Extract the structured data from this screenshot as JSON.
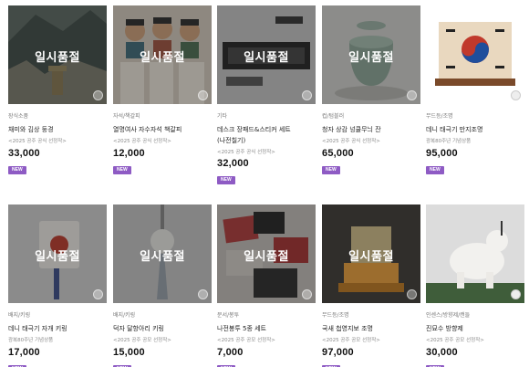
{
  "sold_out_label": "일시품절",
  "new_badge": "NEW",
  "colors": {
    "badge": "#8e5bc4",
    "overlay": "rgba(30,30,30,0.40)"
  },
  "products": [
    {
      "category": "장식소품",
      "name": "채미와 김상 둥경",
      "name2": "",
      "subtitle": "<2025 공주 공식 선정작>",
      "price": "33,000",
      "icon": "mountain-shrine-photo"
    },
    {
      "category": "자석/책갈피",
      "name": "열명여사 자수자석 책갈피",
      "name2": "",
      "subtitle": "<2025 공주 공식 선정작>",
      "price": "12,000",
      "icon": "figurine-magnets-photo"
    },
    {
      "category": "기타",
      "name": "데스크 장패드&스티커 세트",
      "name2": "(나전칠기)",
      "subtitle": "<2025 공주 공식 선정작>",
      "price": "32,000",
      "icon": "desk-pad-photo"
    },
    {
      "category": "컵/텀블러",
      "name": "청자 상감 넝쿨무늬 잔",
      "name2": "",
      "subtitle": "<2025 공주 공식 선정작>",
      "price": "65,000",
      "icon": "celadon-cup-photo"
    },
    {
      "category": "무드등/조명",
      "name": "데니 태극기 만지조명",
      "name2": "",
      "subtitle": "광복80주년 기념상품",
      "price": "95,000",
      "icon": "taegukgi-lamp-photo"
    },
    {
      "category": "배지/키링",
      "name": "데니 태극기 자개 키링",
      "name2": "",
      "subtitle": "광복80주년 기념상품",
      "price": "17,000",
      "icon": "taegukgi-keyring-photo"
    },
    {
      "category": "배지/키링",
      "name": "덕자 달항아리 키링",
      "name2": "",
      "subtitle": "<2025 공주 공모 선정작>",
      "price": "15,000",
      "icon": "moon-jar-keyring-photo"
    },
    {
      "category": "문서/봉투",
      "name": "나전봉투 5종 세트",
      "name2": "",
      "subtitle": "<2025 공주 공모 선정작>",
      "price": "7,000",
      "icon": "envelope-set-photo"
    },
    {
      "category": "무드등/조명",
      "name": "국새 첩영지보 조명",
      "name2": "",
      "subtitle": "<2025 공주 공모 선정작>",
      "price": "97,000",
      "icon": "royal-seal-lamp-photo"
    },
    {
      "category": "인센스/방향제/캔들",
      "name": "진묘수 방향제",
      "name2": "",
      "subtitle": "<2025 공주 공모 선정작>",
      "price": "30,000",
      "icon": "guardian-beast-diffuser-photo"
    }
  ]
}
